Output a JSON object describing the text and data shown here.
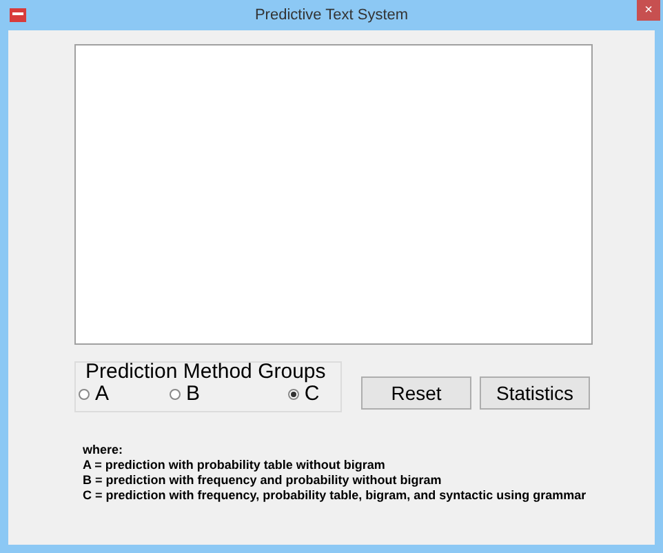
{
  "window": {
    "title": "Predictive Text System",
    "close": "×"
  },
  "group": {
    "title": "Prediction Method Groups",
    "options": [
      {
        "label": "A",
        "selected": false
      },
      {
        "label": "B",
        "selected": false
      },
      {
        "label": "C",
        "selected": true
      }
    ]
  },
  "buttons": [
    "Reset",
    "Statistics"
  ],
  "legend": [
    "where:",
    "A = prediction with probability table without bigram",
    "B = prediction with frequency and probability without bigram",
    "C = prediction with frequency, probability table, bigram, and syntactic using grammar"
  ]
}
